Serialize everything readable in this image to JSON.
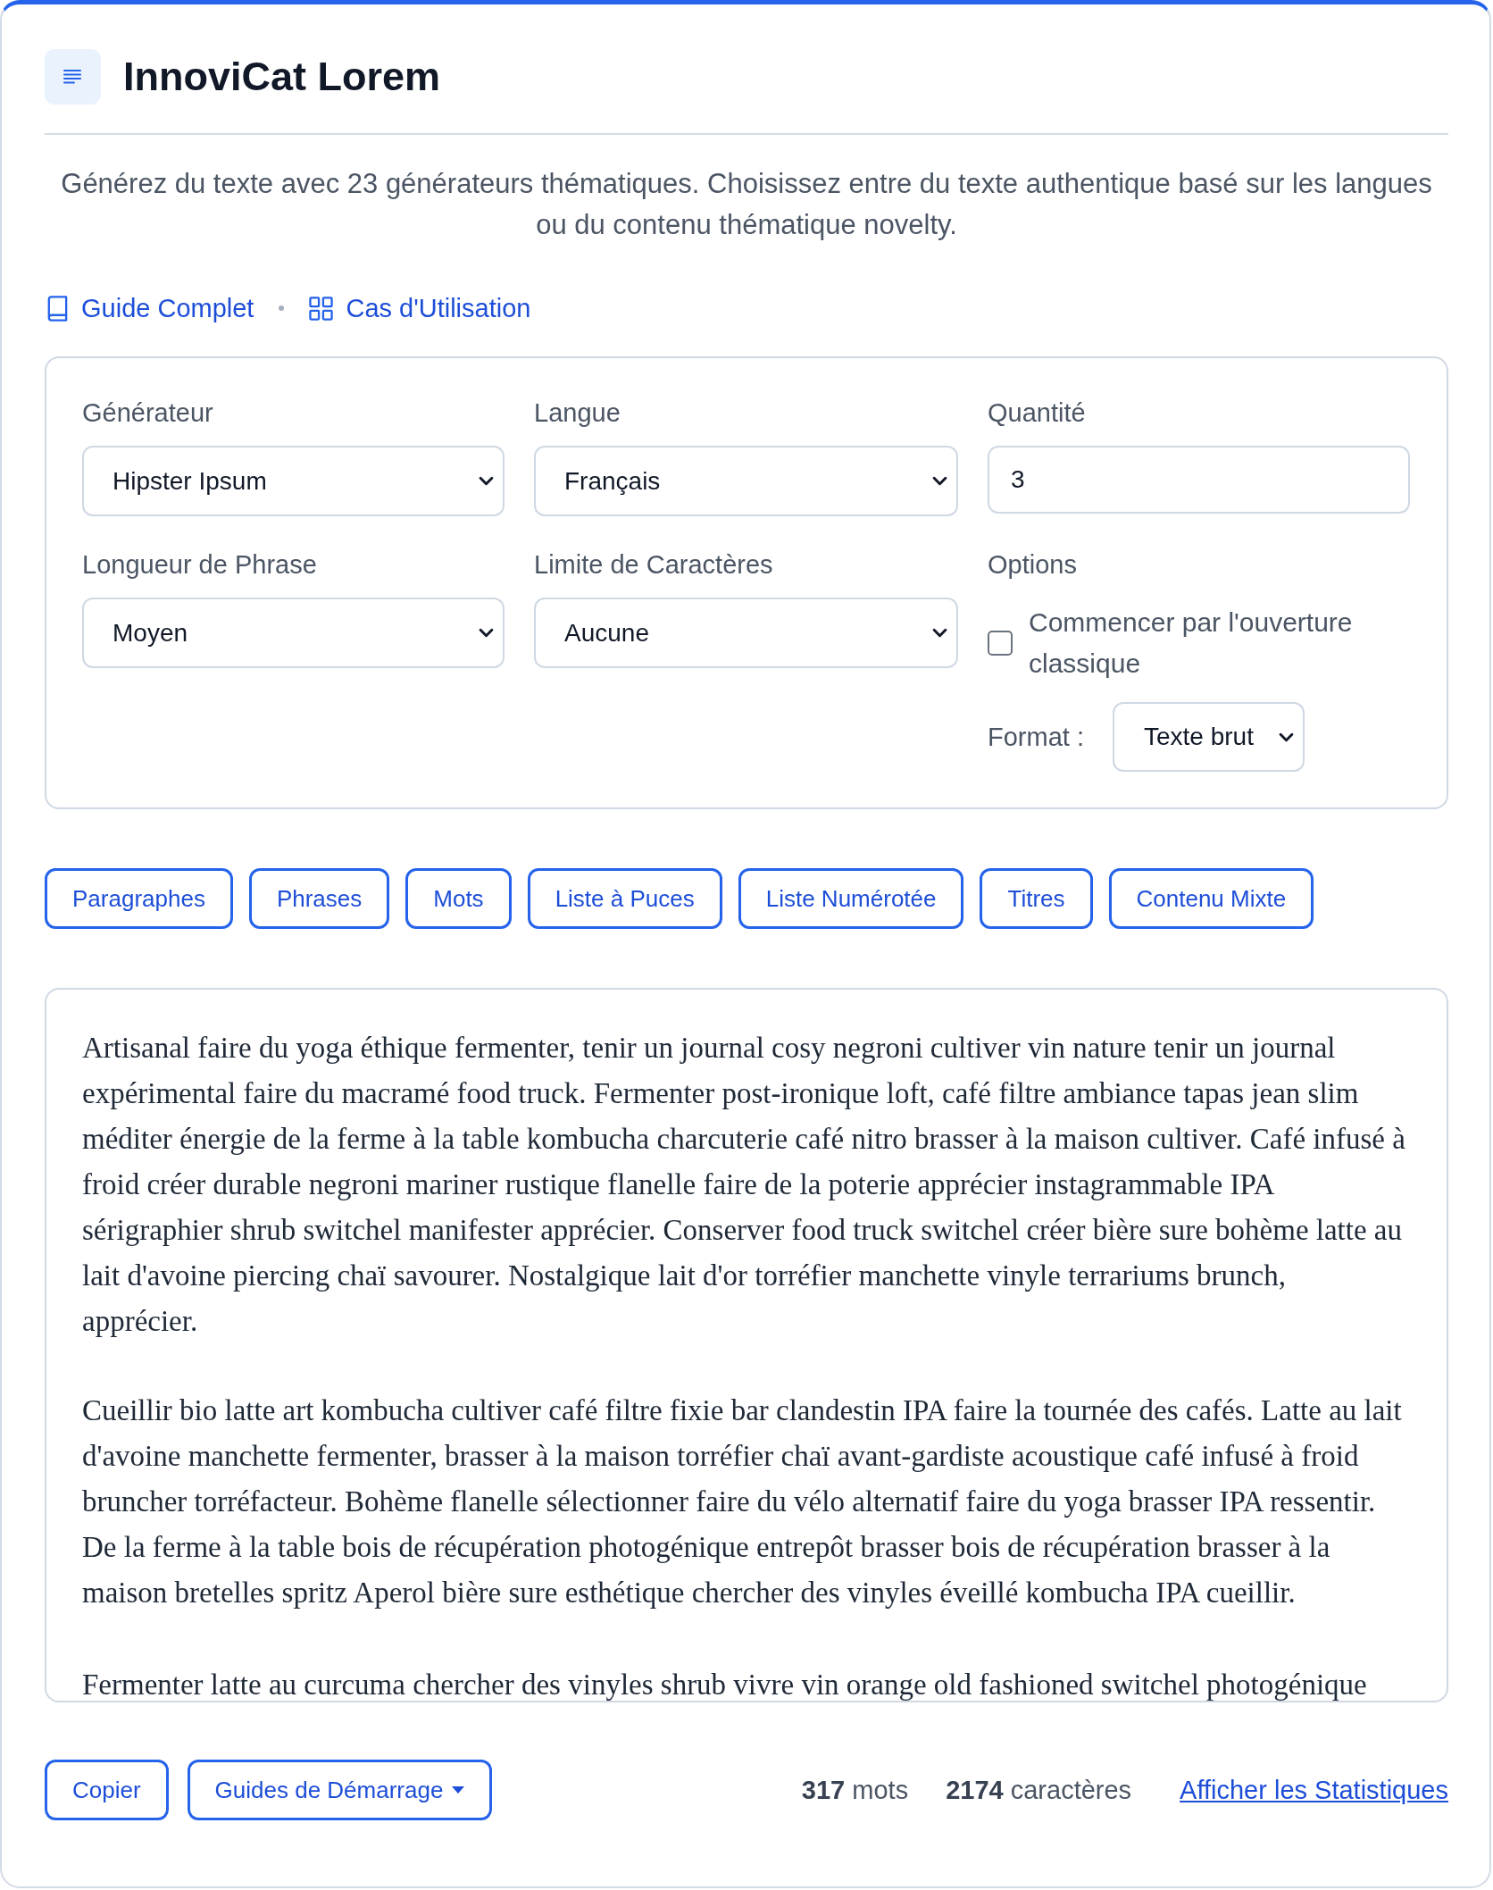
{
  "header": {
    "title": "InnoviCat Lorem",
    "description": "Générez du texte avec 23 générateurs thématiques. Choisissez entre du texte authentique basé sur les langues ou du contenu thématique novelty."
  },
  "links": [
    {
      "label": "Guide Complet",
      "kind": "book"
    },
    {
      "label": "Cas d'Utilisation",
      "kind": "grid"
    }
  ],
  "settings": {
    "fields": [
      {
        "label": "Générateur",
        "kind": "select",
        "value": "Hipster Ipsum"
      },
      {
        "label": "Langue",
        "kind": "select",
        "value": "Français"
      },
      {
        "label": "Quantité",
        "kind": "number",
        "value": "3"
      },
      {
        "label": "Longueur de Phrase",
        "kind": "select",
        "value": "Moyen"
      },
      {
        "label": "Limite de Caractères",
        "kind": "select",
        "value": "Aucune"
      },
      {
        "label": "Options",
        "kind": "options",
        "checkbox": {
          "label": "Commencer par l'ouverture classique",
          "checked": false
        },
        "format": {
          "label": "Format :",
          "value": "Texte brut"
        }
      }
    ]
  },
  "content_types": [
    "Paragraphes",
    "Phrases",
    "Mots",
    "Liste à Puces",
    "Liste Numérotée",
    "Titres",
    "Contenu Mixte"
  ],
  "output": {
    "paragraphs": [
      "Artisanal faire du yoga éthique fermenter, tenir un journal cosy negroni cultiver vin nature tenir un journal expérimental faire du macramé food truck. Fermenter post-ironique loft, café filtre ambiance tapas jean slim méditer énergie de la ferme à la table kombucha charcuterie café nitro brasser à la maison cultiver. Café infusé à froid créer durable negroni mariner rustique flanelle faire de la poterie apprécier instagrammable IPA sérigraphier shrub switchel manifester apprécier. Conserver food truck switchel créer bière sure bohème latte au lait d'avoine piercing chaï savourer. Nostalgique lait d'or torréfier manchette vinyle terrariums brunch, apprécier.",
      "Cueillir bio latte art kombucha cultiver café filtre fixie bar clandestin IPA faire la tournée des cafés. Latte au lait d'avoine manchette fermenter, brasser à la maison torréfier chaï avant-gardiste acoustique café infusé à froid bruncher torréfacteur. Bohème flanelle sélectionner faire du vélo alternatif faire du yoga brasser IPA ressentir. De la ferme à la table bois de récupération photogénique entrepôt brasser bois de récupération brasser à la maison bretelles spritz Aperol bière sure esthétique chercher des vinyles éveillé kombucha IPA cueillir.",
      "Fermenter latte au curcuma chercher des vinyles shrub vivre vin orange old fashioned switchel photogénique"
    ]
  },
  "footer": {
    "actions": [
      {
        "label": "Copier",
        "kind": "button"
      },
      {
        "label": "Guides de Démarrage",
        "kind": "dropdown"
      }
    ],
    "stats": [
      "**317** mots",
      "**2174** caractères"
    ],
    "link": "Afficher les Statistiques"
  }
}
